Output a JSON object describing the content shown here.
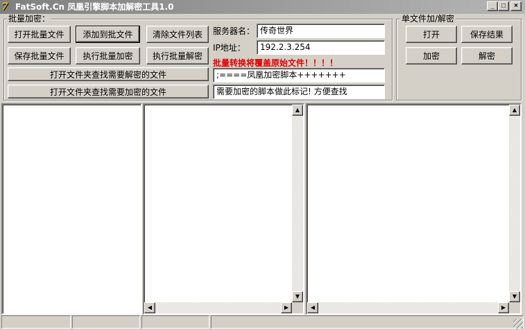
{
  "window": {
    "title": "FatSoft.Cn  凤凰引擎脚本加解密工具1.0",
    "icon": "app-logo-icon",
    "minimize_glyph": "_",
    "maximize_glyph": "□",
    "close_glyph": "×"
  },
  "batch": {
    "legend": "批量加密：",
    "open_batch_file": "打开批量文件",
    "add_to_batch": "添加到批文件",
    "clear_file_list": "清除文件列表",
    "save_batch_file": "保存批量文件",
    "run_batch_encrypt": "执行批量加密",
    "run_batch_decrypt": "执行批量解密",
    "open_folder_decrypt": "打开文件夹查找需要解密的文件",
    "open_folder_encrypt": "打开文件夹查找需要加密的文件",
    "server_label": "服务器名：",
    "server_value": "传奇世界",
    "ip_label": "IP地址：",
    "ip_value": "192.2.3.254",
    "warning": "批量转换将覆盖原始文件！！！！",
    "marker_value": ";====凤凰加密脚本+++++++",
    "hint_value": "需要加密的脚本做此标记! 方便查找"
  },
  "single": {
    "legend": "单文件加/解密",
    "open": "打开",
    "save_result": "保存结果",
    "encrypt": "加密",
    "decrypt": "解密"
  },
  "scroll": {
    "up": "▲",
    "down": "▼",
    "left": "◀",
    "right": "▶"
  }
}
